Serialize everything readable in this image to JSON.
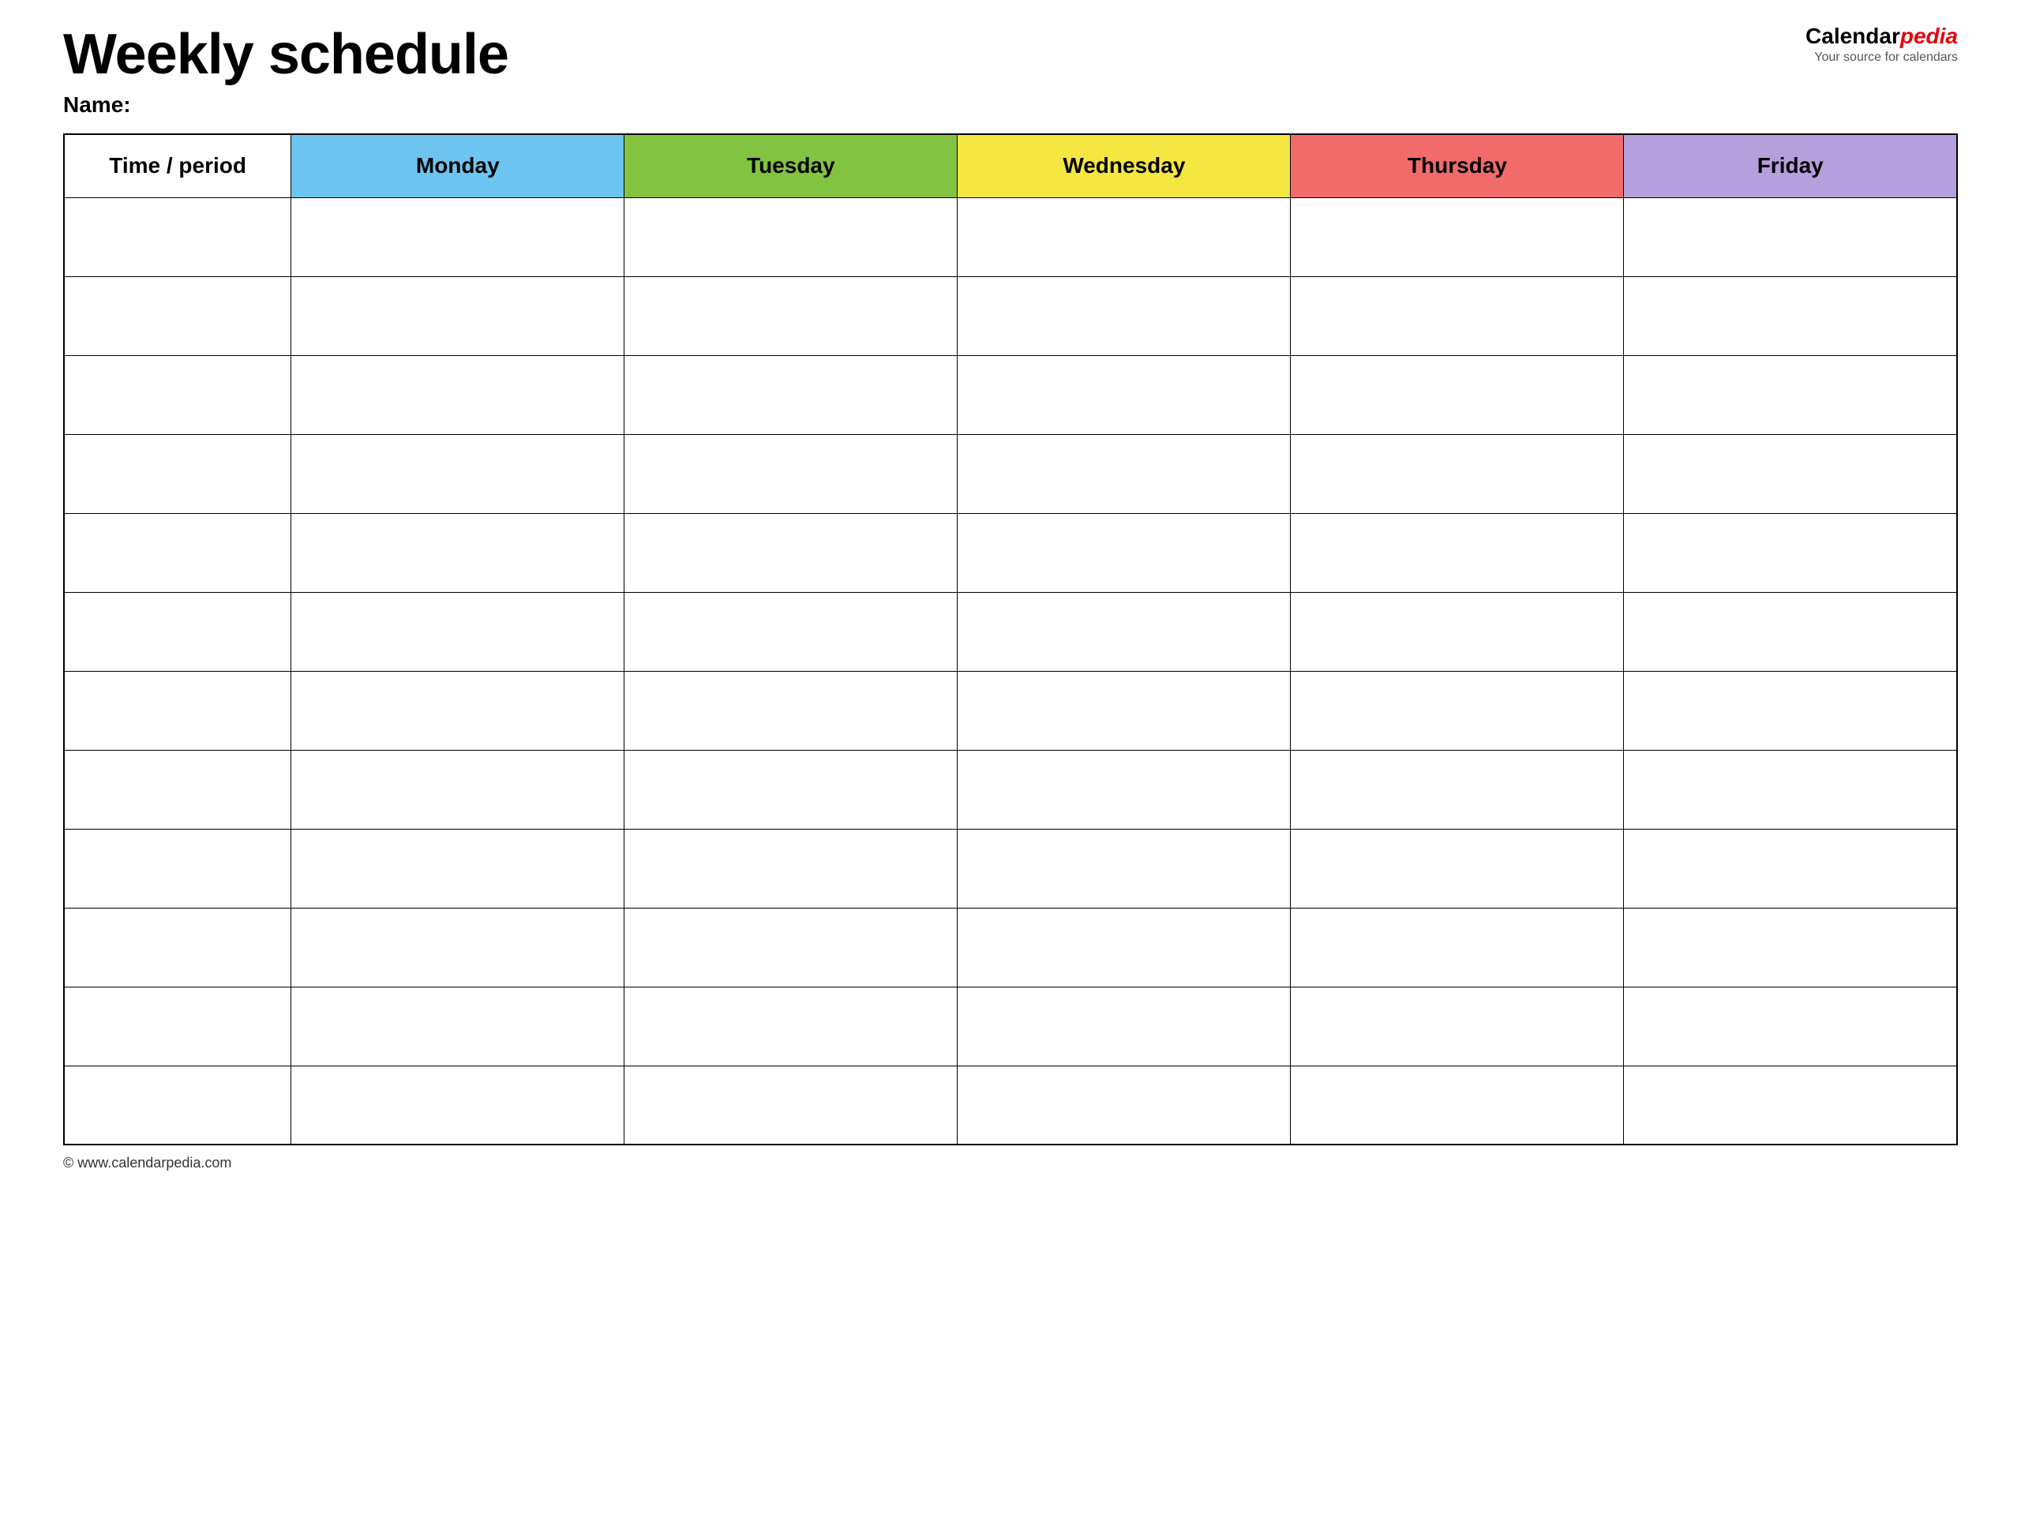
{
  "header": {
    "title": "Weekly schedule",
    "name_label": "Name:",
    "logo_calendar": "Calendar",
    "logo_pedia": "pedia",
    "logo_subtitle": "Your source for calendars"
  },
  "table": {
    "columns": [
      {
        "id": "time",
        "label": "Time / period",
        "color": "#ffffff"
      },
      {
        "id": "monday",
        "label": "Monday",
        "color": "#6ec4f0"
      },
      {
        "id": "tuesday",
        "label": "Tuesday",
        "color": "#82c341"
      },
      {
        "id": "wednesday",
        "label": "Wednesday",
        "color": "#f5e642"
      },
      {
        "id": "thursday",
        "label": "Thursday",
        "color": "#f26b6b"
      },
      {
        "id": "friday",
        "label": "Friday",
        "color": "#b59fdc"
      }
    ],
    "row_count": 12
  },
  "footer": {
    "url": "© www.calendarpedia.com"
  }
}
